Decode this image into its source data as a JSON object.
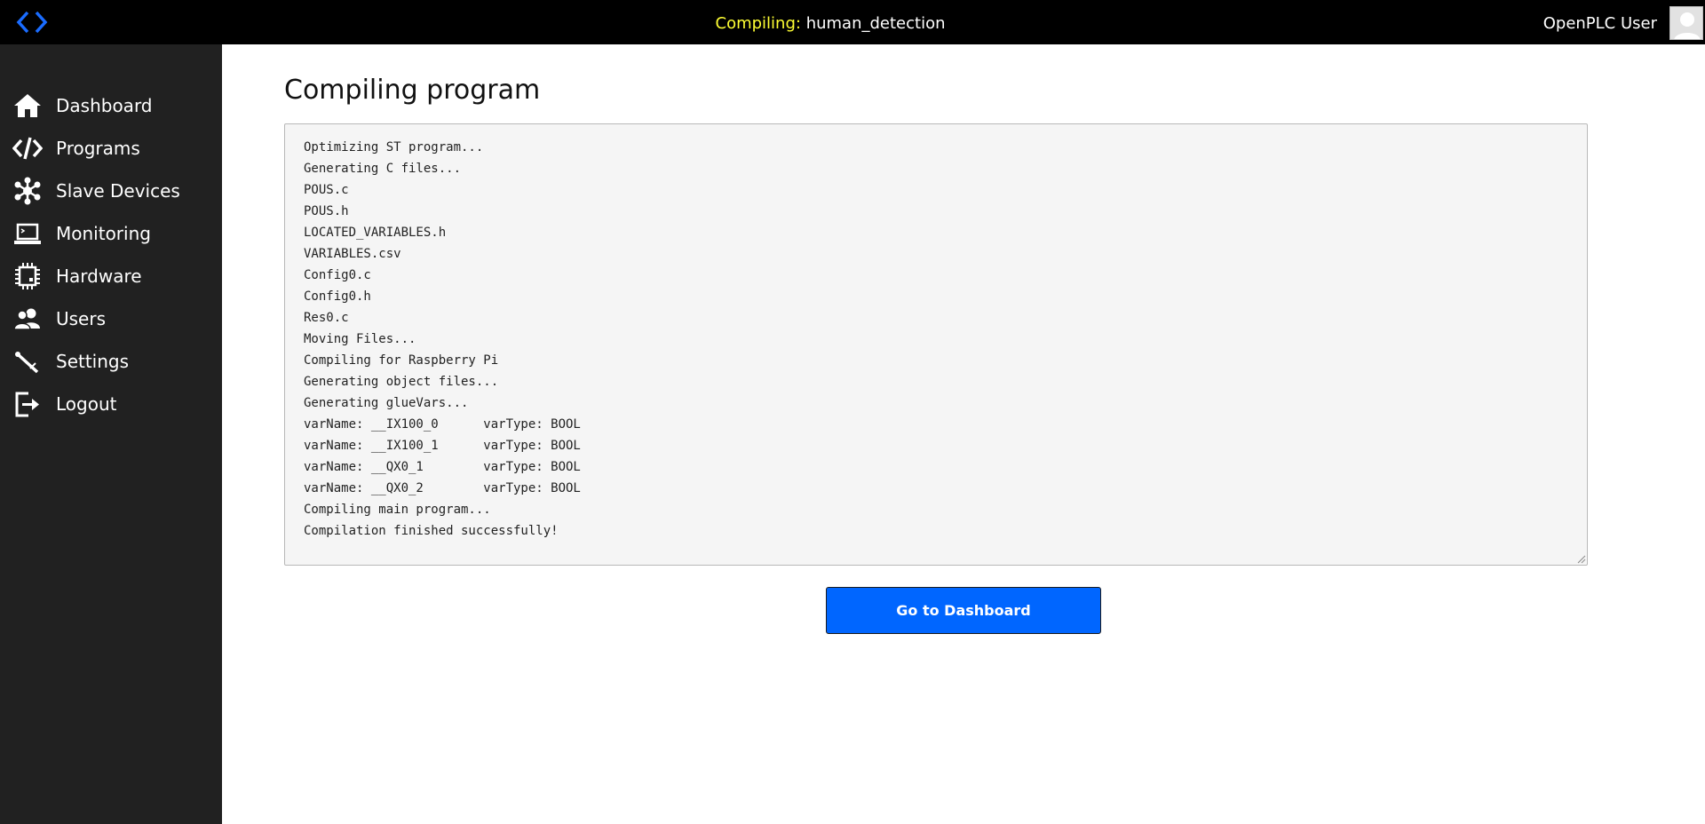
{
  "header": {
    "title_prefix": "Compiling:",
    "title_program": "human_detection",
    "user_name": "OpenPLC User",
    "accent_color": "#ffff33",
    "logo_color": "#1a6cff"
  },
  "sidebar": {
    "items": [
      {
        "label": "Dashboard",
        "icon": "home-icon"
      },
      {
        "label": "Programs",
        "icon": "code-icon"
      },
      {
        "label": "Slave Devices",
        "icon": "network-icon"
      },
      {
        "label": "Monitoring",
        "icon": "laptop-icon"
      },
      {
        "label": "Hardware",
        "icon": "chip-icon"
      },
      {
        "label": "Users",
        "icon": "users-icon"
      },
      {
        "label": "Settings",
        "icon": "wrench-icon"
      },
      {
        "label": "Logout",
        "icon": "logout-icon"
      }
    ]
  },
  "main": {
    "page_title": "Compiling program",
    "log_lines": [
      "Optimizing ST program...",
      "Generating C files...",
      "POUS.c",
      "POUS.h",
      "LOCATED_VARIABLES.h",
      "VARIABLES.csv",
      "Config0.c",
      "Config0.h",
      "Res0.c",
      "Moving Files...",
      "Compiling for Raspberry Pi",
      "Generating object files...",
      "Generating glueVars...",
      "varName: __IX100_0      varType: BOOL",
      "varName: __IX100_1      varType: BOOL",
      "varName: __QX0_1        varType: BOOL",
      "varName: __QX0_2        varType: BOOL",
      "Compiling main program...",
      "Compilation finished successfully!"
    ],
    "button_label": "Go to Dashboard",
    "button_color": "#0066ff"
  }
}
